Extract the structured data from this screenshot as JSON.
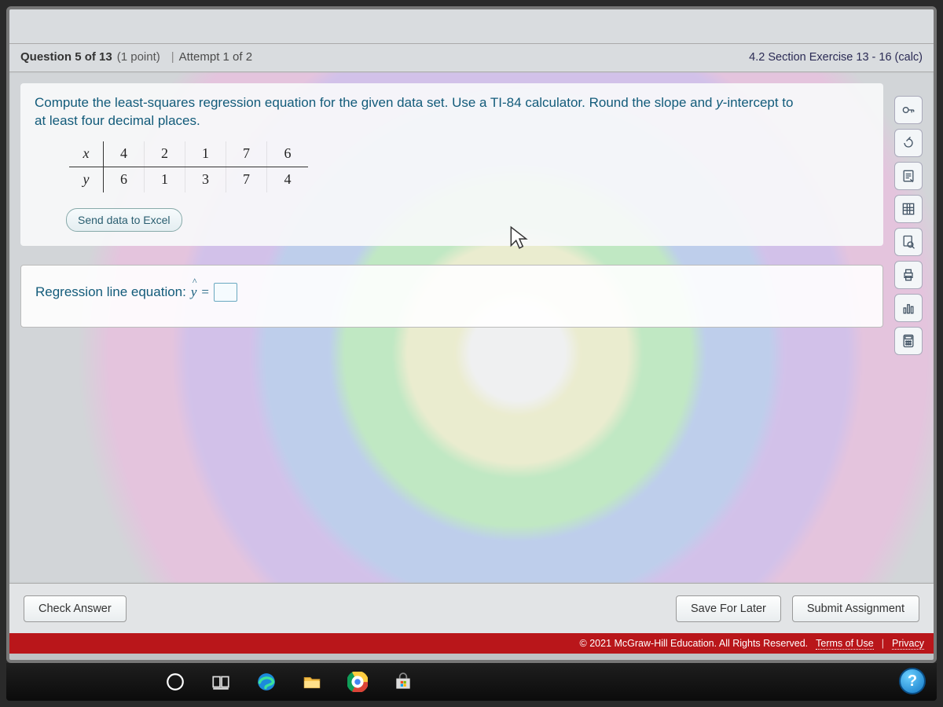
{
  "header": {
    "question_prefix": "Question",
    "question_num": "5",
    "question_of": "of",
    "question_total": "13",
    "points": "(1 point)",
    "attempt": "Attempt 1 of 2",
    "exercise_ref": "4.2 Section Exercise 13 - 16 (calc)"
  },
  "prompt": {
    "line1a": "Compute the least-squares regression equation for the given data set. Use a TI-84 calculator. Round the slope and ",
    "yint": "y",
    "line1b": "-intercept to",
    "line2": "at least four decimal places."
  },
  "table": {
    "row_labels": [
      "x",
      "y"
    ],
    "x": [
      "4",
      "2",
      "1",
      "7",
      "6"
    ],
    "y": [
      "6",
      "1",
      "3",
      "7",
      "4"
    ]
  },
  "buttons": {
    "send_excel": "Send data to Excel",
    "check_answer": "Check Answer",
    "save_later": "Save For Later",
    "submit": "Submit Assignment"
  },
  "answer": {
    "label_prefix": "Regression line equation:",
    "equals": "="
  },
  "footer": {
    "copyright": "© 2021 McGraw-Hill Education. All Rights Reserved.",
    "terms": "Terms of Use",
    "privacy": "Privacy"
  },
  "tools": {
    "t1": "key",
    "t2": "redo",
    "t3": "notepad",
    "t4": "grid",
    "t5": "search-doc",
    "t6": "print",
    "t7": "bar-chart",
    "t8": "calculator"
  },
  "taskbar": {
    "help": "?"
  }
}
